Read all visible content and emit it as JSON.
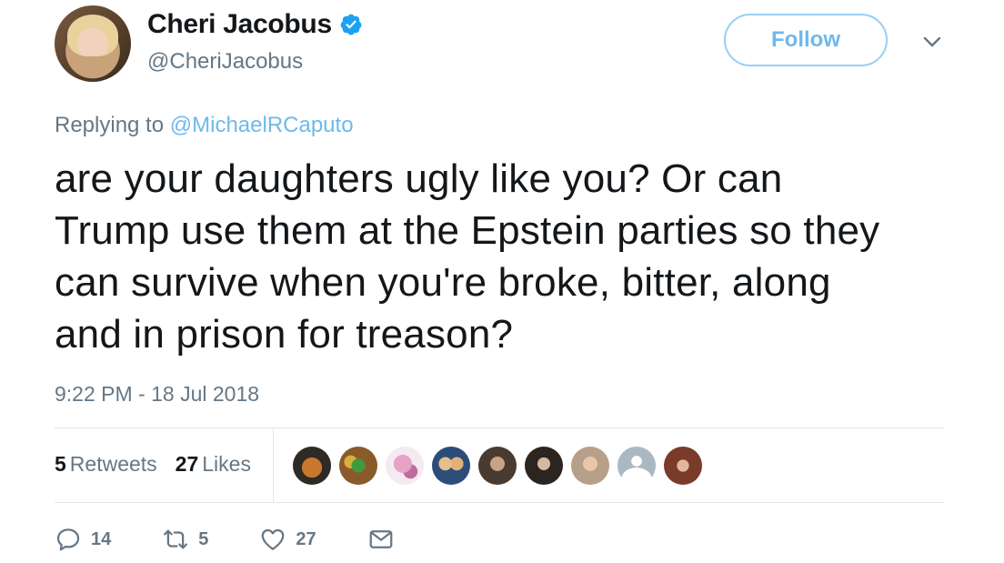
{
  "user": {
    "display_name": "Cheri Jacobus",
    "handle": "@CheriJacobus",
    "verified": true
  },
  "header": {
    "follow_label": "Follow"
  },
  "reply": {
    "prefix": "Replying to ",
    "mention": "@MichaelRCaputo"
  },
  "tweet": {
    "text": "are your daughters ugly like you?  Or can\nTrump use them at the Epstein parties so they\ncan survive when you're broke, bitter, along\nand in prison for treason?",
    "timestamp": "9:22 PM - 18 Jul 2018"
  },
  "stats": {
    "retweets_count": "5",
    "retweets_label": "Retweets",
    "likes_count": "27",
    "likes_label": "Likes"
  },
  "actions": {
    "reply_count": "14",
    "retweet_count": "5",
    "like_count": "27"
  },
  "colors": {
    "accent": "#1da1f2",
    "text": "#14171a",
    "muted": "#657786",
    "divider": "#e1e8ed"
  }
}
